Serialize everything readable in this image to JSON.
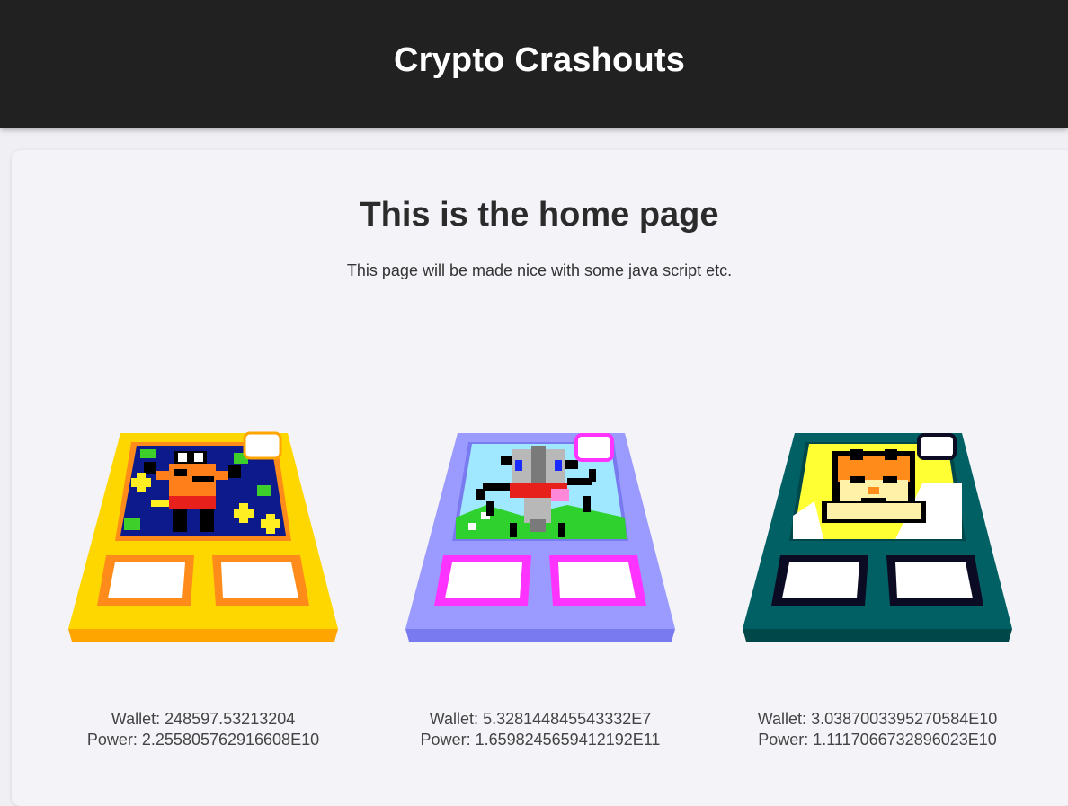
{
  "header": {
    "title": "Crypto Crashouts"
  },
  "main": {
    "heading": "This is the home page",
    "subtext": "This page will be made nice with some java script etc."
  },
  "cards": [
    {
      "wallet": "Wallet: 248597.53213204",
      "power": "Power: 2.255805762916608E10",
      "colors": {
        "frame": "#ffd700",
        "frame_side": "#ffa500",
        "accent": "#ff8c1a",
        "art_bg": "#0c1a8c"
      }
    },
    {
      "wallet": "Wallet: 5.328144845543332E7",
      "power": "Power: 1.6598245659412192E11",
      "colors": {
        "frame": "#9b9bff",
        "frame_side": "#7a7af0",
        "accent": "#ff33ff",
        "art_bg": "#9fe8ff"
      }
    },
    {
      "wallet": "Wallet: 3.0387003395270584E10",
      "power": "Power: 1.1117066732896023E10",
      "colors": {
        "frame": "#006064",
        "frame_side": "#00474a",
        "accent": "#0b0b24",
        "art_bg": "#ffff33"
      }
    }
  ]
}
